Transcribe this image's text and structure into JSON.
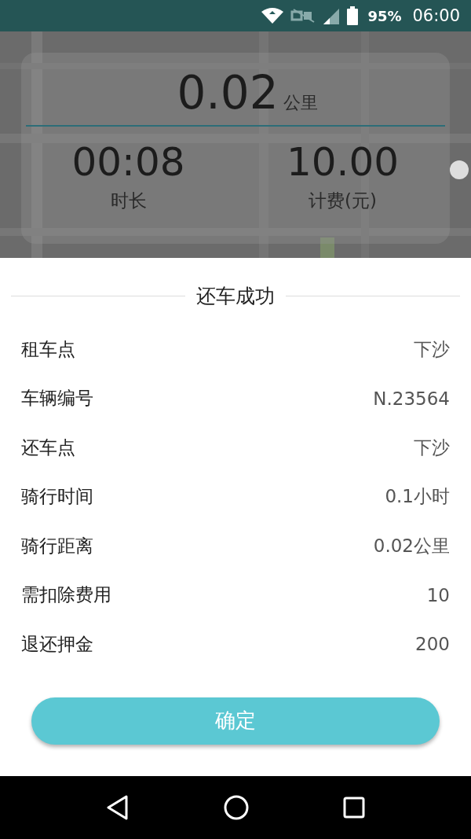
{
  "status_bar": {
    "battery": "95%",
    "time": "06:00"
  },
  "trip_card": {
    "distance": "0.02",
    "distance_unit": "公里",
    "duration": "00:08",
    "duration_label": "时长",
    "fee": "10.00",
    "fee_label": "计费(元)"
  },
  "dialog": {
    "title": "还车成功",
    "rows": [
      {
        "label": "租车点",
        "value": "下沙"
      },
      {
        "label": "车辆编号",
        "value": "N.23564"
      },
      {
        "label": "还车点",
        "value": "下沙"
      },
      {
        "label": "骑行时间",
        "value": "0.1小时"
      },
      {
        "label": "骑行距离",
        "value": "0.02公里"
      },
      {
        "label": "需扣除费用",
        "value": "10"
      },
      {
        "label": "退还押金",
        "value": "200"
      }
    ],
    "confirm_button": "确定"
  }
}
